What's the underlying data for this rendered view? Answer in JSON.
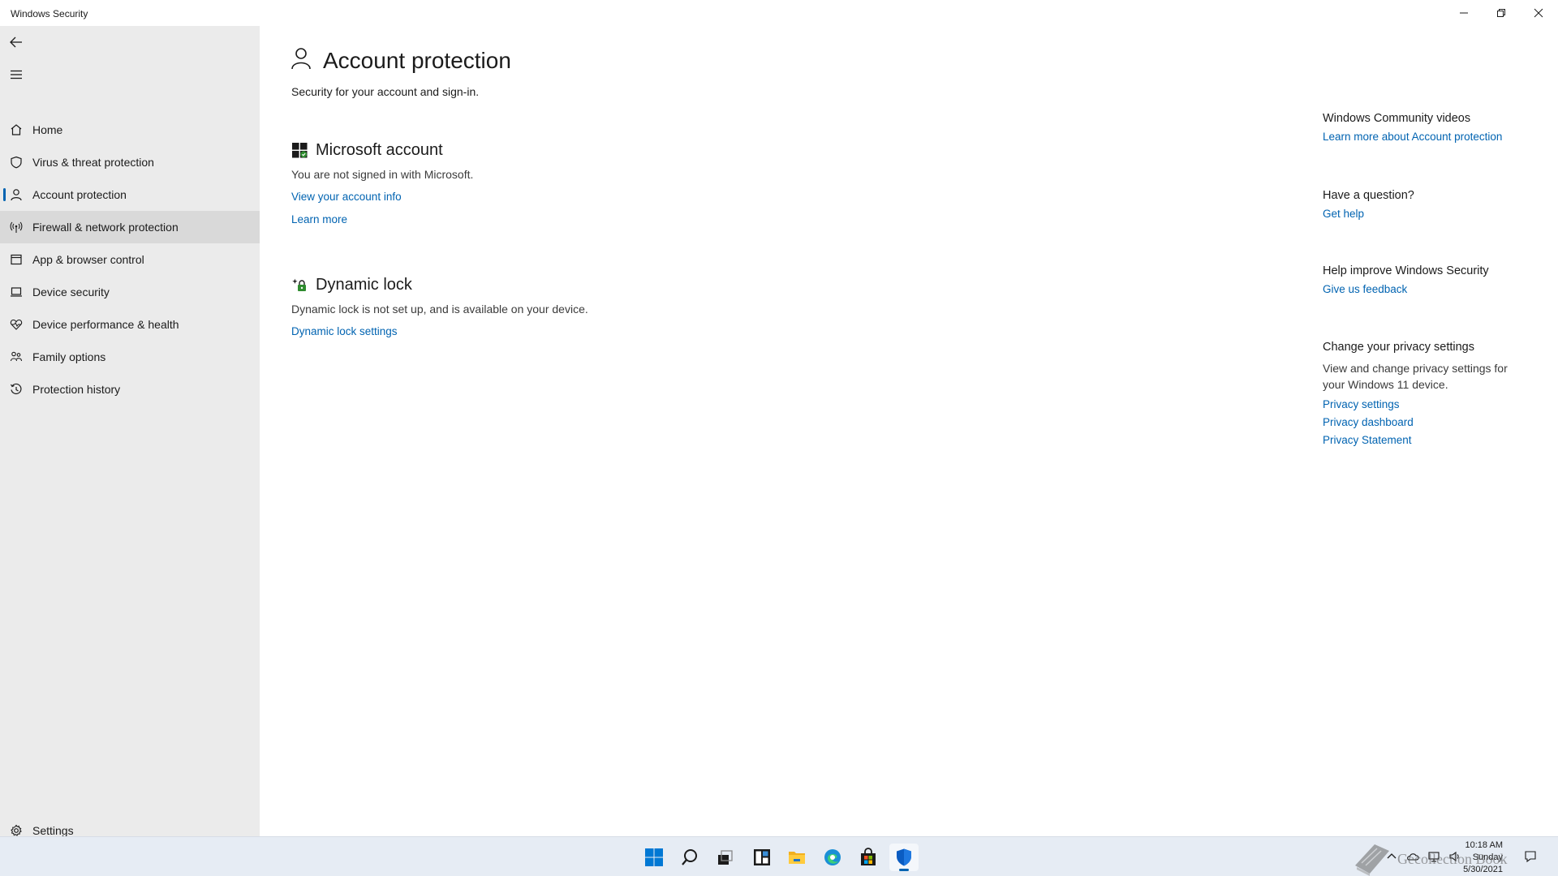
{
  "window": {
    "title": "Windows Security",
    "minimize_icon": "minimize-icon",
    "restore_icon": "restore-icon",
    "close_icon": "close-icon"
  },
  "sidebar": {
    "back_icon": "back-arrow-icon",
    "menu_icon": "hamburger-menu-icon",
    "items": [
      {
        "label": "Home",
        "icon": "home-icon"
      },
      {
        "label": "Virus & threat protection",
        "icon": "shield-icon"
      },
      {
        "label": "Account protection",
        "icon": "person-icon",
        "selected": true
      },
      {
        "label": "Firewall & network protection",
        "icon": "antenna-icon",
        "hover": true
      },
      {
        "label": "App & browser control",
        "icon": "app-window-icon"
      },
      {
        "label": "Device security",
        "icon": "laptop-icon"
      },
      {
        "label": "Device performance & health",
        "icon": "heart-icon"
      },
      {
        "label": "Family options",
        "icon": "family-icon"
      },
      {
        "label": "Protection history",
        "icon": "history-icon"
      }
    ],
    "settings_label": "Settings"
  },
  "main": {
    "title": "Account protection",
    "subtitle": "Security for your account and sign-in.",
    "microsoft_account": {
      "title": "Microsoft account",
      "description": "You are not signed in with Microsoft.",
      "links": [
        "View your account info",
        "Learn more"
      ]
    },
    "dynamic_lock": {
      "title": "Dynamic lock",
      "description": "Dynamic lock is not set up, and is available on your device.",
      "link": "Dynamic lock settings"
    }
  },
  "right_panel": {
    "community": {
      "heading": "Windows Community videos",
      "link": "Learn more about Account protection"
    },
    "question": {
      "heading": "Have a question?",
      "link": "Get help"
    },
    "improve": {
      "heading": "Help improve Windows Security",
      "link": "Give us feedback"
    },
    "privacy": {
      "heading": "Change your privacy settings",
      "text": "View and change privacy settings for your Windows 11 device.",
      "links": [
        "Privacy settings",
        "Privacy dashboard",
        "Privacy Statement"
      ]
    }
  },
  "taskbar": {
    "icons": [
      "start-icon",
      "search-icon",
      "task-view-icon",
      "widgets-icon",
      "file-explorer-icon",
      "edge-icon",
      "store-icon",
      "windows-security-icon"
    ],
    "active": "windows-security-icon",
    "clock": {
      "time": "10:18 AM",
      "day": "Sunday",
      "date": "5/30/2021"
    },
    "watermark": "Gecollection Book"
  },
  "colors": {
    "accent": "#0063b1",
    "sidebar_bg": "#ebebeb",
    "taskbar_bg": "#e6ecf4"
  }
}
